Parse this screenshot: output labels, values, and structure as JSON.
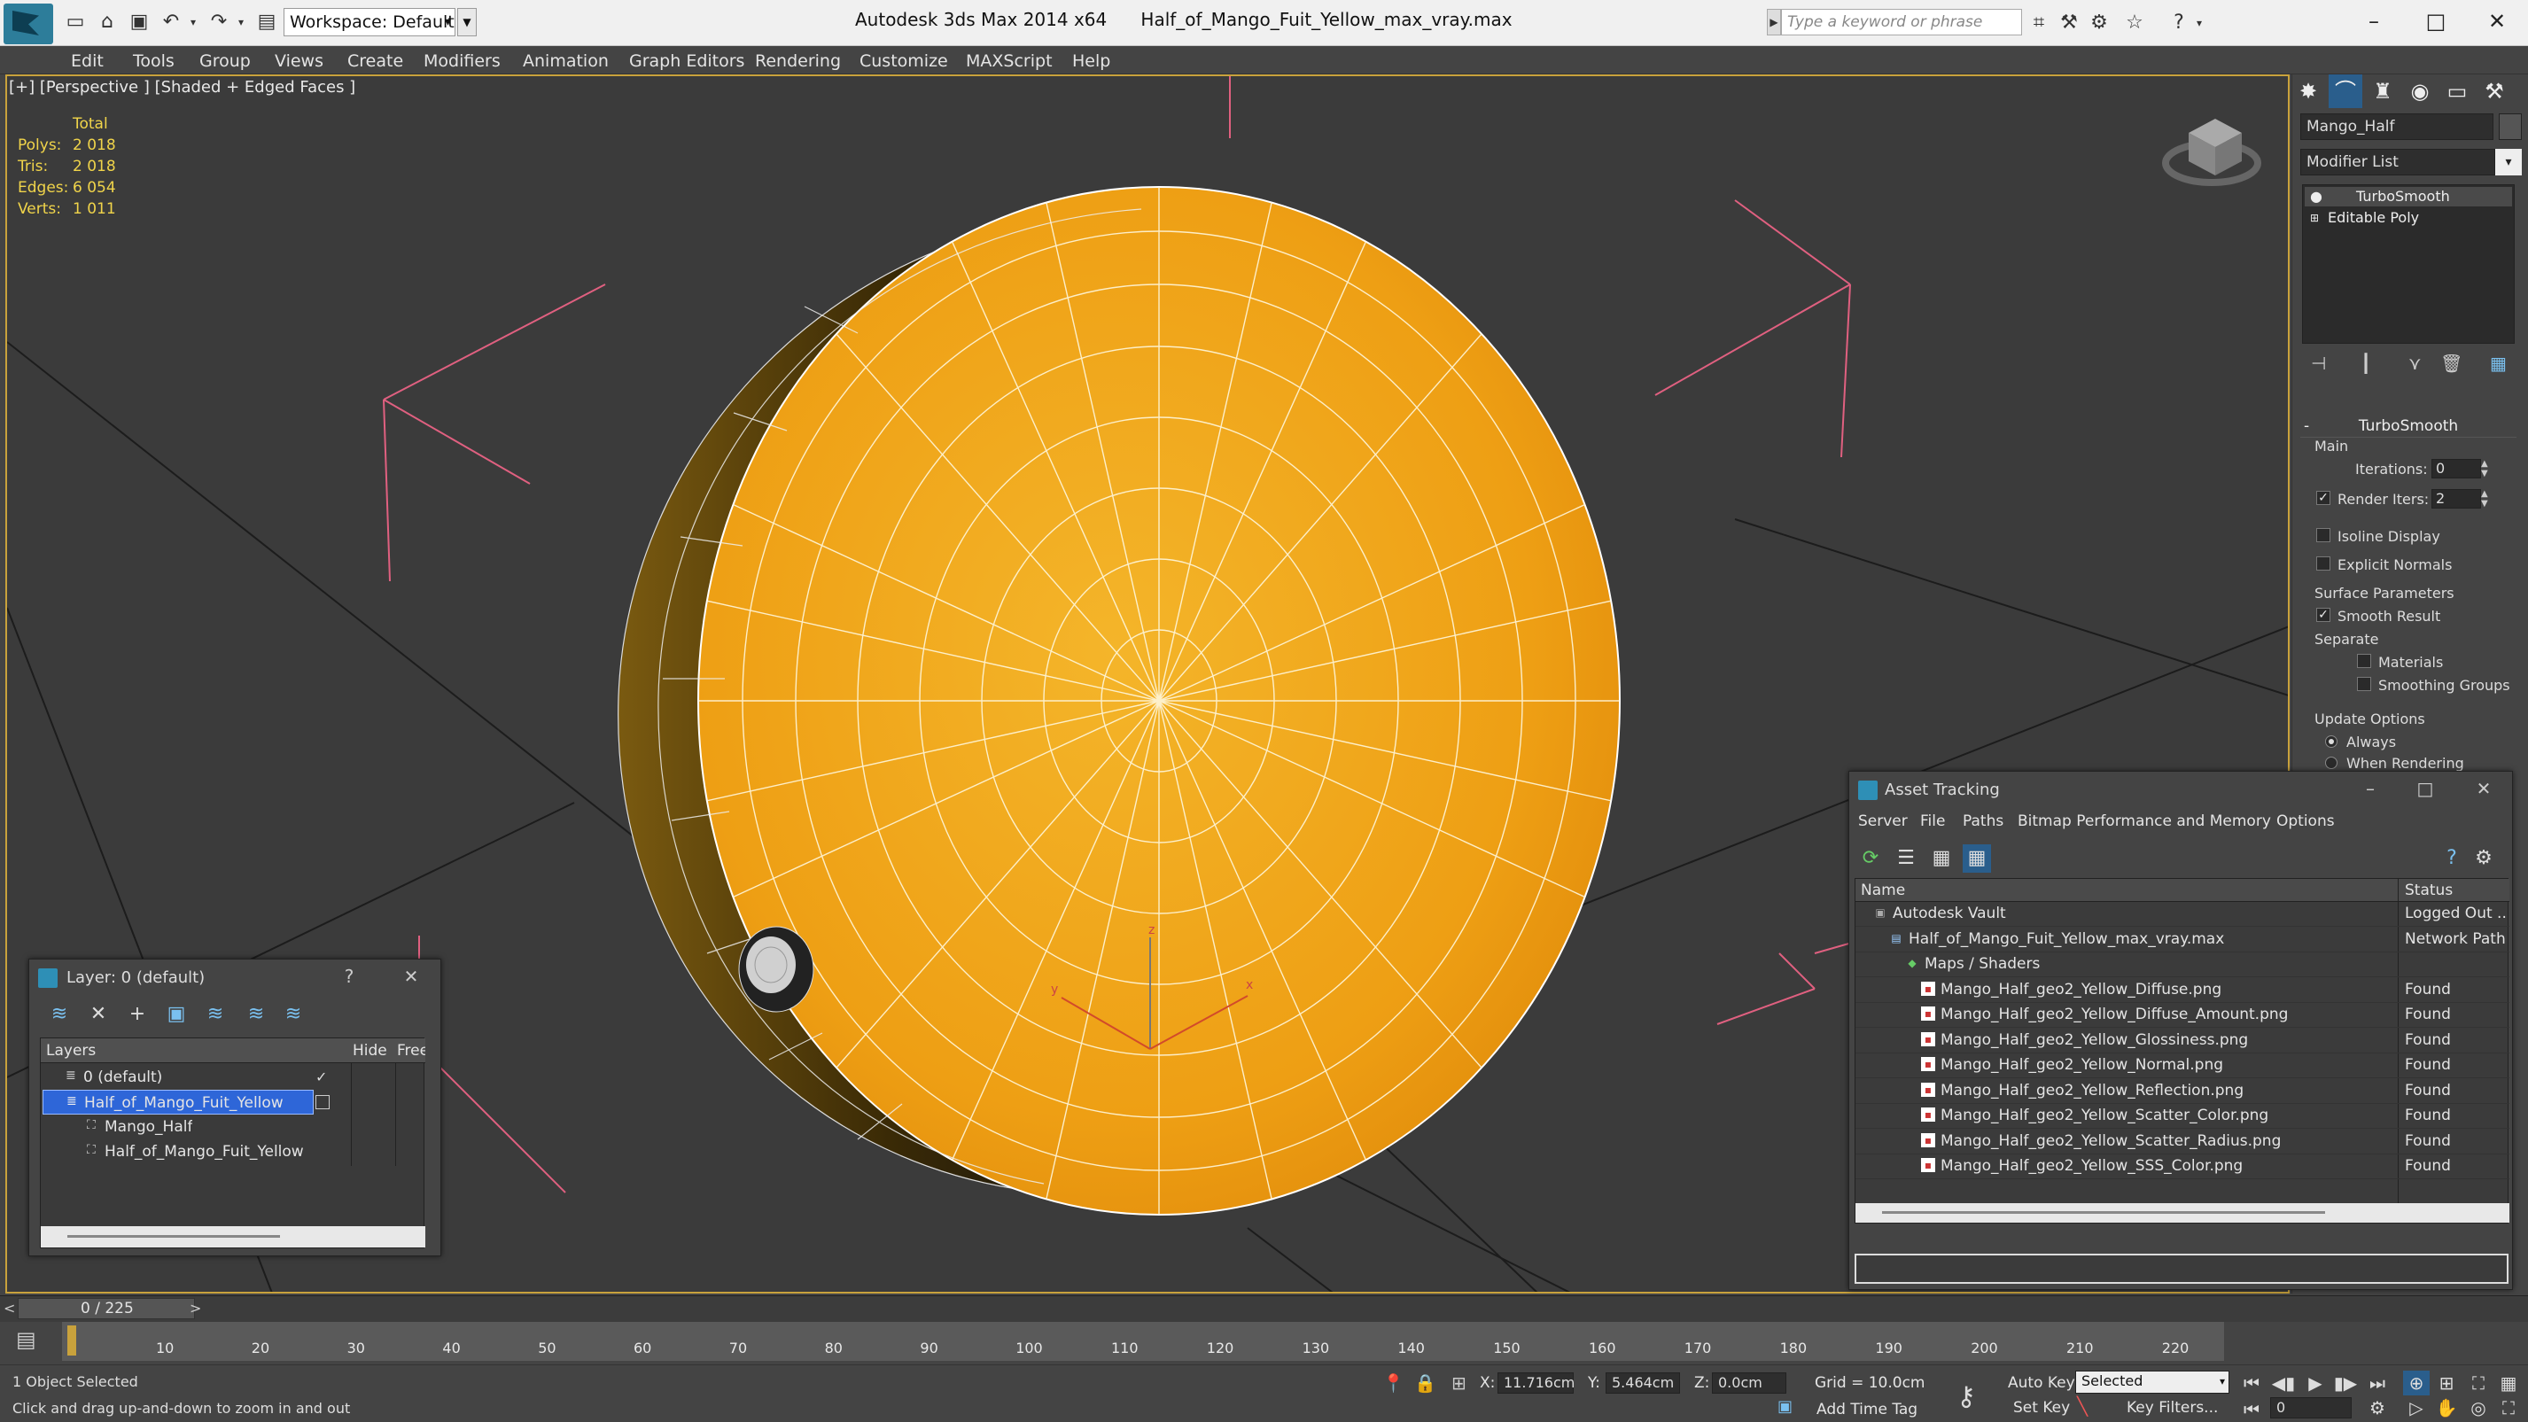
{
  "title_bar": {
    "workspace_label": "Workspace: Default",
    "app_title": "Autodesk 3ds Max  2014 x64",
    "file_title": "Half_of_Mango_Fuit_Yellow_max_vray.max",
    "search_placeholder": "Type a keyword or phrase"
  },
  "menu": [
    "Edit",
    "Tools",
    "Group",
    "Views",
    "Create",
    "Modifiers",
    "Animation",
    "Graph Editors",
    "Rendering",
    "Customize",
    "MAXScript",
    "Help"
  ],
  "viewport": {
    "label": "[+] [Perspective ] [Shaded + Edged Faces ]",
    "stats": {
      "header": "Total",
      "rows": [
        {
          "label": "Polys:",
          "value": "2 018"
        },
        {
          "label": "Tris:",
          "value": "2 018"
        },
        {
          "label": "Edges:",
          "value": "6 054"
        },
        {
          "label": "Verts:",
          "value": "1 011"
        }
      ]
    },
    "gizmo_labels": {
      "x": "x",
      "y": "y",
      "z": "z"
    }
  },
  "command_panel": {
    "object_name": "Mango_Half",
    "modifier_list": "Modifier List",
    "stack": [
      "TurboSmooth",
      "Editable Poly"
    ],
    "turbosmooth": {
      "header": "TurboSmooth",
      "main_label": "Main",
      "iterations_label": "Iterations:",
      "iterations_value": "0",
      "render_iters_label": "Render Iters:",
      "render_iters_value": "2",
      "isoline_label": "Isoline Display",
      "explicit_label": "Explicit Normals",
      "surface_label": "Surface Parameters",
      "smooth_label": "Smooth Result",
      "separate_label": "Separate",
      "materials_label": "Materials",
      "smoothing_label": "Smoothing Groups",
      "update_label": "Update Options",
      "always_label": "Always",
      "when_rendering_label": "When Rendering"
    }
  },
  "layer_dialog": {
    "title": "Layer: 0 (default)",
    "help": "?",
    "columns": {
      "layers": "Layers",
      "hide": "Hide",
      "freeze": "Free"
    },
    "rows": [
      {
        "name": "0 (default)",
        "indent": 1,
        "selected": false,
        "current": true
      },
      {
        "name": "Half_of_Mango_Fuit_Yellow",
        "indent": 1,
        "selected": true,
        "current": false
      },
      {
        "name": "Mango_Half",
        "indent": 2,
        "selected": false,
        "current": false
      },
      {
        "name": "Half_of_Mango_Fuit_Yellow",
        "indent": 2,
        "selected": false,
        "current": false
      }
    ]
  },
  "asset_tracking": {
    "title": "Asset Tracking",
    "menu": [
      "Server",
      "File",
      "Paths",
      "Bitmap Performance and Memory",
      "Options"
    ],
    "columns": {
      "name": "Name",
      "status": "Status"
    },
    "rows": [
      {
        "name": "Autodesk Vault",
        "status": "Logged Out ...",
        "indent": 1,
        "icon": "vault-icon"
      },
      {
        "name": "Half_of_Mango_Fuit_Yellow_max_vray.max",
        "status": "Network Path",
        "indent": 2,
        "icon": "max-file-icon"
      },
      {
        "name": "Maps / Shaders",
        "status": "",
        "indent": 3,
        "icon": "maps-icon"
      },
      {
        "name": "Mango_Half_geo2_Yellow_Diffuse.png",
        "status": "Found",
        "indent": 4,
        "icon": "png-icon"
      },
      {
        "name": "Mango_Half_geo2_Yellow_Diffuse_Amount.png",
        "status": "Found",
        "indent": 4,
        "icon": "png-icon"
      },
      {
        "name": "Mango_Half_geo2_Yellow_Glossiness.png",
        "status": "Found",
        "indent": 4,
        "icon": "png-icon"
      },
      {
        "name": "Mango_Half_geo2_Yellow_Normal.png",
        "status": "Found",
        "indent": 4,
        "icon": "png-icon"
      },
      {
        "name": "Mango_Half_geo2_Yellow_Reflection.png",
        "status": "Found",
        "indent": 4,
        "icon": "png-icon"
      },
      {
        "name": "Mango_Half_geo2_Yellow_Scatter_Color.png",
        "status": "Found",
        "indent": 4,
        "icon": "png-icon"
      },
      {
        "name": "Mango_Half_geo2_Yellow_Scatter_Radius.png",
        "status": "Found",
        "indent": 4,
        "icon": "png-icon"
      },
      {
        "name": "Mango_Half_geo2_Yellow_SSS_Color.png",
        "status": "Found",
        "indent": 4,
        "icon": "png-icon"
      }
    ]
  },
  "timeline": {
    "frame_readout": "0 / 225",
    "ticks": [
      "10",
      "20",
      "30",
      "40",
      "50",
      "60",
      "70",
      "80",
      "90",
      "100",
      "110",
      "120",
      "130",
      "140",
      "150",
      "160",
      "170",
      "180",
      "190",
      "200",
      "210",
      "220"
    ]
  },
  "status_bar": {
    "selection": "1 Object Selected",
    "prompt": "Click and drag up-and-down to zoom in and out",
    "x_label": "X:",
    "x_value": "11.716cm",
    "y_label": "Y:",
    "y_value": "5.464cm",
    "z_label": "Z:",
    "z_value": "0.0cm",
    "grid": "Grid = 10.0cm",
    "add_time_tag": "Add Time Tag",
    "auto_key": "Auto Key",
    "selected": "Selected",
    "set_key": "Set Key",
    "key_filters": "Key Filters...",
    "frame": "0"
  },
  "colors": {
    "mango_yellow": "#f0ac1e",
    "viewport_border": "#c9a23c",
    "stats_text": "#f0d44a",
    "selection_blue": "#2e66d8",
    "bbox_pink": "#e06080"
  }
}
